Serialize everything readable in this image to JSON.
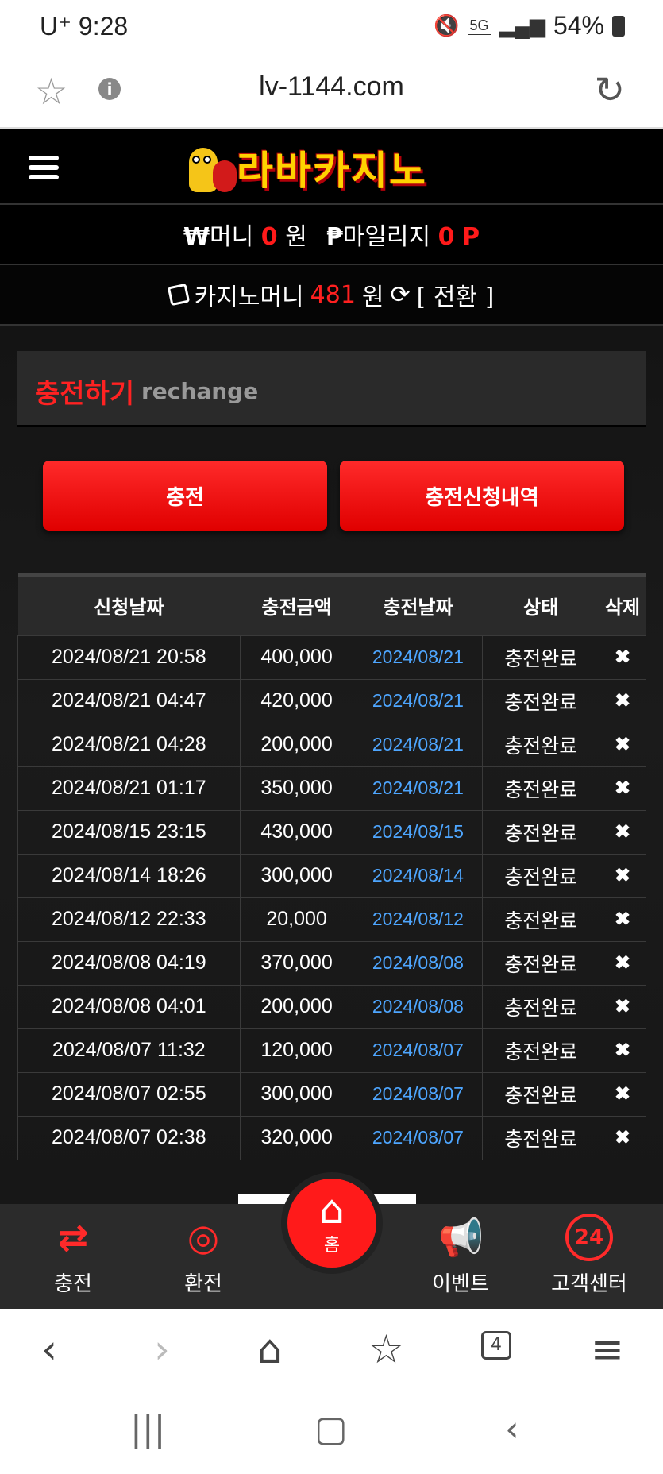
{
  "status_bar": {
    "time": "U⁺ 9:28",
    "network": "5G",
    "battery": "54%"
  },
  "browser": {
    "url": "lv-1144.com"
  },
  "site": {
    "logo_text": "라바카지노",
    "money": {
      "won_symbol": "₩",
      "money_label": "머니",
      "money_value": "0",
      "money_unit": "원",
      "mileage_symbol": "₱",
      "mileage_label": "마일리지",
      "mileage_value": "0",
      "mileage_unit": "P"
    },
    "casino": {
      "label": "카지노머니",
      "value": "481",
      "unit": "원",
      "convert": "[ 전환 ]"
    },
    "section": {
      "title_ko": "충전하기",
      "title_en": "rechange"
    },
    "buttons": {
      "charge": "충전",
      "history": "충전신청내역"
    },
    "table": {
      "headers": [
        "신청날짜",
        "충전금액",
        "충전날짜",
        "상태",
        "삭제"
      ],
      "rows": [
        [
          "2024/08/21 20:58",
          "400,000",
          "2024/08/21",
          "충전완료",
          "✖"
        ],
        [
          "2024/08/21 04:47",
          "420,000",
          "2024/08/21",
          "충전완료",
          "✖"
        ],
        [
          "2024/08/21 04:28",
          "200,000",
          "2024/08/21",
          "충전완료",
          "✖"
        ],
        [
          "2024/08/21 01:17",
          "350,000",
          "2024/08/21",
          "충전완료",
          "✖"
        ],
        [
          "2024/08/15 23:15",
          "430,000",
          "2024/08/15",
          "충전완료",
          "✖"
        ],
        [
          "2024/08/14 18:26",
          "300,000",
          "2024/08/14",
          "충전완료",
          "✖"
        ],
        [
          "2024/08/12 22:33",
          "20,000",
          "2024/08/12",
          "충전완료",
          "✖"
        ],
        [
          "2024/08/08 04:19",
          "370,000",
          "2024/08/08",
          "충전완료",
          "✖"
        ],
        [
          "2024/08/08 04:01",
          "200,000",
          "2024/08/08",
          "충전완료",
          "✖"
        ],
        [
          "2024/08/07 11:32",
          "120,000",
          "2024/08/07",
          "충전완료",
          "✖"
        ],
        [
          "2024/08/07 02:55",
          "300,000",
          "2024/08/07",
          "충전완료",
          "✖"
        ],
        [
          "2024/08/07 02:38",
          "320,000",
          "2024/08/07",
          "충전완료",
          "✖"
        ]
      ]
    },
    "bottom_nav": {
      "charge": "충전",
      "exchange": "환전",
      "home": "홈",
      "event": "이벤트",
      "support": "고객센터",
      "support_badge": "24"
    }
  },
  "browser_nav": {
    "tab_count": "4"
  },
  "colors": {
    "accent_red": "#ff1a1a",
    "date_blue": "#4ea6ff",
    "logo_yellow": "#ffd200"
  }
}
